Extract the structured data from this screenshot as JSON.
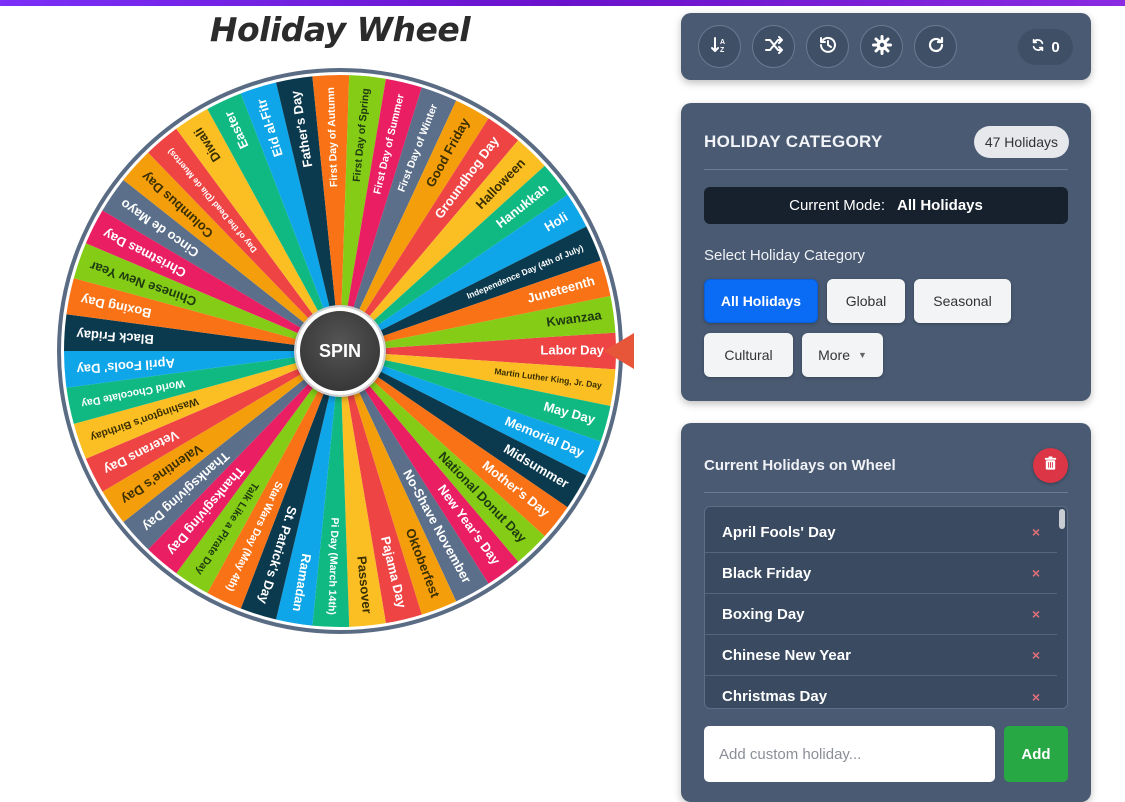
{
  "app": {
    "title": "Holiday Wheel",
    "spin_label": "SPIN"
  },
  "wheel": {
    "colors": [
      "#ef4444",
      "#fbbf24",
      "#10b981",
      "#0ea5e9",
      "#0b3a4e",
      "#f97316",
      "#84cc16",
      "#e91e63",
      "#5b6f8a",
      "#f59e0b"
    ],
    "segments": [
      "Labor Day",
      "Martin Luther King, Jr. Day",
      "May Day",
      "Memorial Day",
      "Midsummer",
      "Mother's Day",
      "National Donut Day",
      "New Year's Day",
      "No-Shave November",
      "Oktoberfest",
      "Pajama Day",
      "Passover",
      "Pi Day (March 14th)",
      "Ramadan",
      "St. Patrick's Day",
      "Star Wars Day (May 4th)",
      "Talk Like a Pirate Day",
      "Thanksgiving Day",
      "Thanksgiving Day",
      "Valentine's Day",
      "Veterans Day",
      "Washington's Birthday",
      "World Chocolate Day",
      "April Fools' Day",
      "Black Friday",
      "Boxing Day",
      "Chinese New Year",
      "Christmas Day",
      "Cinco de Mayo",
      "Columbus Day",
      "Day of the Dead (Dia de Muertos)",
      "Diwali",
      "Easter",
      "Eid al-Fitr",
      "Father's Day",
      "First Day of Autumn",
      "First Day of Spring",
      "First Day of Summer",
      "First Day of Winter",
      "Good Friday",
      "Groundhog Day",
      "Halloween",
      "Hanukkah",
      "Holi",
      "Independence Day (4th of July)",
      "Juneteenth",
      "Kwanzaa"
    ]
  },
  "toolbar": {
    "buttons": [
      {
        "name": "sort-button",
        "icon": "sort-icon"
      },
      {
        "name": "shuffle-button",
        "icon": "shuffle-icon"
      },
      {
        "name": "history-button",
        "icon": "history-icon"
      },
      {
        "name": "settings-button",
        "icon": "gear-icon"
      },
      {
        "name": "redo-button",
        "icon": "redo-icon"
      }
    ],
    "spin_count": "0"
  },
  "category": {
    "title": "HOLIDAY CATEGORY",
    "count_badge": "47 Holidays",
    "mode_label": "Current Mode:",
    "mode_value": "All Holidays",
    "select_label": "Select Holiday Category",
    "chips": {
      "all": "All Holidays",
      "global": "Global",
      "seasonal": "Seasonal",
      "cultural": "Cultural",
      "more": "More"
    }
  },
  "current": {
    "title": "Current Holidays on Wheel",
    "items": [
      "April Fools' Day",
      "Black Friday",
      "Boxing Day",
      "Chinese New Year",
      "Christmas Day"
    ],
    "remove_symbol": "×",
    "input_placeholder": "Add custom holiday...",
    "add_label": "Add"
  }
}
